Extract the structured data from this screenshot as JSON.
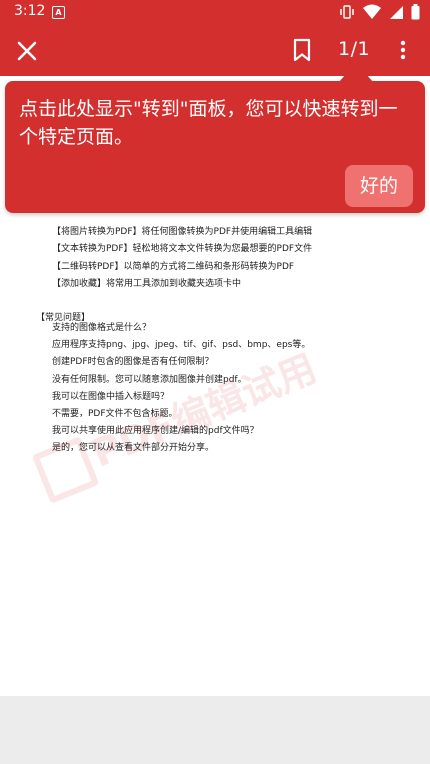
{
  "status_bar": {
    "time": "3:12",
    "notification": "A"
  },
  "toolbar": {
    "page_indicator": "1/1"
  },
  "tooltip": {
    "message": "点击此处显示\"转到\"面板，您可以快速转到一个特定页面。",
    "ok_label": "好的"
  },
  "pdf": {
    "lines": [
      "【将图片转换为PDF】将任何图像转换为PDF并使用编辑工具编辑",
      "【文本转换为PDF】轻松地将文本文件转换为您最想要的PDF文件",
      "【二维码转PDF】以简单的方式将二维码和条形码转换为PDF",
      "【添加收藏】将常用工具添加到收藏夹选项卡中",
      "【常见问题】",
      "支持的图像格式是什么？",
      "应用程序支持png、jpg、jpeg、tif、gif、psd、bmp、eps等。",
      "创建PDF时包含的图像是否有任何限制？",
      "没有任何限制。您可以随意添加图像并创建pdf。",
      "我可以在图像中插入标题吗？",
      "不需要，PDF文件不包含标题。",
      "我可以共享使用此应用程序创建/编辑的pdf文件吗？",
      "是的，您可以从查看文件部分开始分享。"
    ],
    "watermark": "PDF编辑试用"
  }
}
